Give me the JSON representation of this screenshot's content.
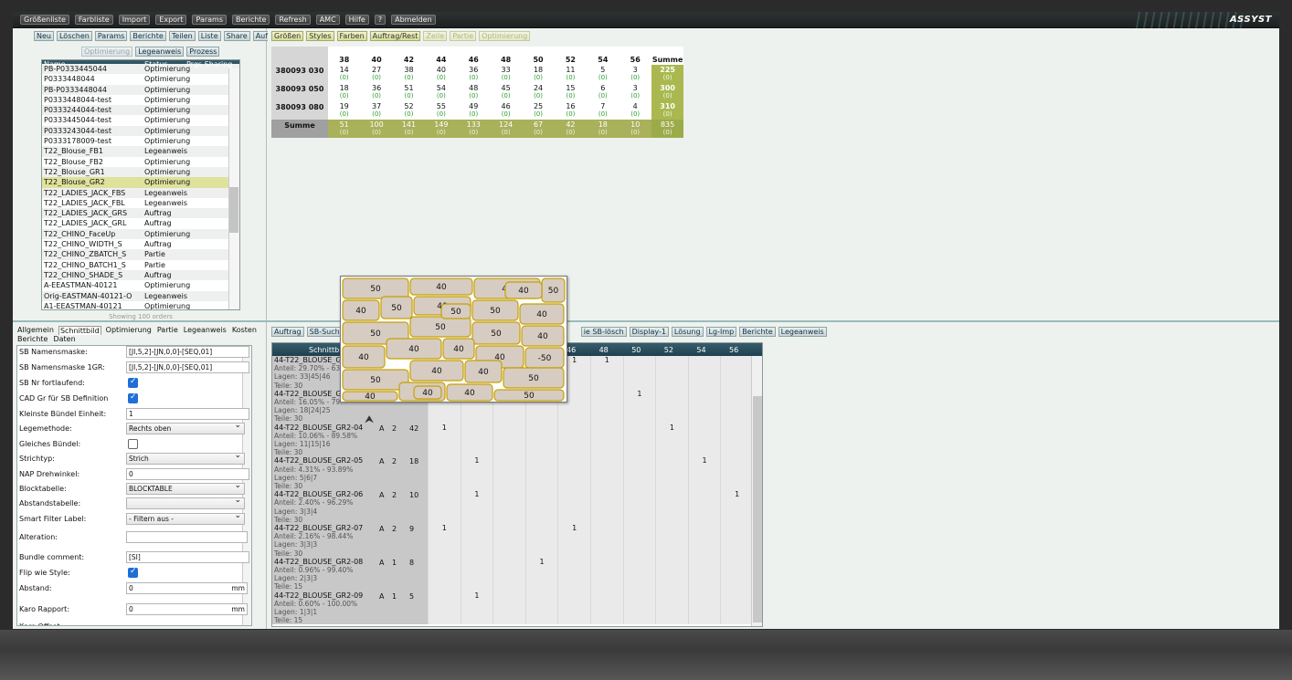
{
  "brand": "ASSYST",
  "menu": [
    "Größenliste",
    "Farbliste",
    "Import",
    "Export",
    "Params",
    "Berichte",
    "Refresh",
    "AMC",
    "Hilfe",
    "?",
    "Abmelden"
  ],
  "left_toolbar": [
    "Neu",
    "Löschen",
    "Params",
    "Berichte",
    "Teilen",
    "Liste",
    "Share",
    "Auftrag"
  ],
  "left_toolbar2": [
    {
      "label": "Optimierung",
      "disabled": true
    },
    {
      "label": "Legeanweis",
      "disabled": false
    },
    {
      "label": "Prozess",
      "disabled": false
    }
  ],
  "orders": {
    "columns": [
      "Name",
      "Status",
      "Prgs Sharing"
    ],
    "rows": [
      [
        "PB-P0333445044",
        "Optimierung"
      ],
      [
        "P0333448044",
        "Optimierung"
      ],
      [
        "PB-P0333448044",
        "Optimierung"
      ],
      [
        "P0333448044-test",
        "Optimierung"
      ],
      [
        "P0333244044-test",
        "Optimierung"
      ],
      [
        "P0333445044-test",
        "Optimierung"
      ],
      [
        "P0333243044-test",
        "Optimierung"
      ],
      [
        "P0333178009-test",
        "Optimierung"
      ],
      [
        "T22_Blouse_FB1",
        "Legeanweis"
      ],
      [
        "T22_Blouse_FB2",
        "Optimierung"
      ],
      [
        "T22_Blouse_GR1",
        "Optimierung"
      ],
      [
        "T22_Blouse_GR2",
        "Optimierung"
      ],
      [
        "T22_LADIES_JACK_FBS",
        "Legeanweis"
      ],
      [
        "T22_LADIES_JACK_FBL",
        "Legeanweis"
      ],
      [
        "T22_LADIES_JACK_GRS",
        "Auftrag"
      ],
      [
        "T22_LADIES_JACK_GRL",
        "Auftrag"
      ],
      [
        "T22_CHINO_FaceUp",
        "Optimierung"
      ],
      [
        "T22_CHINO_WIDTH_S",
        "Auftrag"
      ],
      [
        "T22_CHINO_ZBATCH_S",
        "Partie"
      ],
      [
        "T22_CHINO_BATCH1_S",
        "Partie"
      ],
      [
        "T22_CHINO_SHADE_S",
        "Auftrag"
      ],
      [
        "A-EEASTMAN-40121",
        "Optimierung"
      ],
      [
        "Orig-EASTMAN-40121-O",
        "Legeanweis"
      ],
      [
        "A1-EEASTMAN-40121",
        "Optimierung"
      ]
    ],
    "selected_index": 11,
    "footer": "Showing 100 orders"
  },
  "right_toolbar": [
    {
      "label": "Größen",
      "disabled": false
    },
    {
      "label": "Styles",
      "disabled": false
    },
    {
      "label": "Farben",
      "disabled": false
    },
    {
      "label": "Auftrag/Rest",
      "disabled": false
    },
    {
      "label": "Zeile",
      "disabled": true
    },
    {
      "label": "Partie",
      "disabled": true
    },
    {
      "label": "Optimierung",
      "disabled": true
    }
  ],
  "size_grid": {
    "sizes": [
      "38",
      "40",
      "42",
      "44",
      "46",
      "48",
      "50",
      "52",
      "54",
      "56"
    ],
    "sum_label": "Summe",
    "marker": "*",
    "rows": [
      {
        "label": "380093 030",
        "values": [
          "14",
          "27",
          "38",
          "40",
          "36",
          "33",
          "18",
          "11",
          "5",
          "3"
        ],
        "sum": "225"
      },
      {
        "label": "380093 050",
        "values": [
          "18",
          "36",
          "51",
          "54",
          "48",
          "45",
          "24",
          "15",
          "6",
          "3"
        ],
        "sum": "300"
      },
      {
        "label": "380093 080",
        "values": [
          "19",
          "37",
          "52",
          "55",
          "49",
          "46",
          "25",
          "16",
          "7",
          "4"
        ],
        "sum": "310"
      }
    ],
    "total": {
      "label": "Summe",
      "values": [
        "51",
        "100",
        "141",
        "149",
        "133",
        "124",
        "67",
        "42",
        "18",
        "10"
      ],
      "sum": "835"
    },
    "zero": "(0)"
  },
  "left_tabs": [
    "Allgemein",
    "Schnittbild",
    "Optimierung",
    "Partie",
    "Legeanweis",
    "Kosten",
    "Berichte",
    "Daten"
  ],
  "active_tab": "Schnittbild",
  "form": {
    "sb_namensmaske": {
      "label": "SB Namensmaske:",
      "value": "[JI,5,2]-[JN,0,0]-[SEQ,01]"
    },
    "sb_namensmaske_1gr": {
      "label": "SB Namensmaske 1GR:",
      "value": "[JI,5,2]-[JN,0,0]-[SEQ,01]"
    },
    "sb_nr_fortlaufend": {
      "label": "SB Nr fortlaufend:"
    },
    "cad_gr": {
      "label": "CAD Gr für SB Definition"
    },
    "kleinste_buendel": {
      "label": "Kleinste Bündel Einheit:",
      "value": "1"
    },
    "legemethode": {
      "label": "Legemethode:",
      "value": "Rechts oben"
    },
    "gleiches_buendel": {
      "label": "Gleiches Bündel:"
    },
    "strichtyp": {
      "label": "Strichtyp:",
      "value": "Strich"
    },
    "nap_drehwinkel": {
      "label": "NAP Drehwinkel:",
      "value": "0"
    },
    "blocktabelle": {
      "label": "Blocktabelle:",
      "value": "BLOCKTABLE"
    },
    "abstandstabelle": {
      "label": "Abstandstabelle:",
      "value": ""
    },
    "smart_filter": {
      "label": "Smart Filter Label:",
      "value": "- Filtern aus -"
    },
    "alteration": {
      "label": "Alteration:",
      "value": ""
    },
    "bundle_comment": {
      "label": "Bundle comment:",
      "value": "[SI]"
    },
    "flip_wie_style": {
      "label": "Flip wie Style:"
    },
    "abstand": {
      "label": "Abstand:",
      "value": "0",
      "unit": "mm"
    },
    "karo_rapport": {
      "label": "Karo Rapport:",
      "value": "0",
      "unit": "mm"
    },
    "karo_offset": {
      "label": "Karo Offset:"
    }
  },
  "bottom_toolbar": [
    "Auftrag",
    "SB-Suchen",
    "ie SB-lösch",
    "Display-1",
    "Lösung",
    "Lg-Imp",
    "Berichte",
    "Legeanweis"
  ],
  "sb_grid": {
    "header_first": "Schnittbi",
    "header_sizes": [
      "46",
      "48",
      "50",
      "52",
      "54",
      "56"
    ],
    "rows": [
      {
        "name": "44-T22_BLOUSE_G",
        "anteil": "Anteil: 29.70% - 63.",
        "lagen": "Lagen: 33|45|46",
        "teile": "Teile: 30",
        "a": "",
        "b": "",
        "c": "",
        "marks": [
          4,
          5
        ]
      },
      {
        "name": "44-T22_BLOUSE_G",
        "anteil": "Anteil: 16.05% - 79.",
        "lagen": "Lagen: 18|24|25",
        "teile": "Teile: 30",
        "a": "",
        "b": "",
        "c": "",
        "marks": [
          6
        ]
      },
      {
        "name": "44-T22_BLOUSE_GR2-04",
        "anteil": "Anteil: 10.06% - 89.58%",
        "lagen": "Lagen: 11|15|16",
        "teile": "Teile: 30",
        "a": "A",
        "b": "2",
        "c": "42",
        "marks": [
          0,
          7
        ]
      },
      {
        "name": "44-T22_BLOUSE_GR2-05",
        "anteil": "Anteil: 4.31% - 93.89%",
        "lagen": "Lagen: 5|6|7",
        "teile": "Teile: 30",
        "a": "A",
        "b": "2",
        "c": "18",
        "marks": [
          1,
          8
        ]
      },
      {
        "name": "44-T22_BLOUSE_GR2-06",
        "anteil": "Anteil: 2.40% - 96.29%",
        "lagen": "Lagen: 3|3|4",
        "teile": "Teile: 30",
        "a": "A",
        "b": "2",
        "c": "10",
        "marks": [
          1,
          9
        ]
      },
      {
        "name": "44-T22_BLOUSE_GR2-07",
        "anteil": "Anteil: 2.16% - 98.44%",
        "lagen": "Lagen: 3|3|3",
        "teile": "Teile: 30",
        "a": "A",
        "b": "2",
        "c": "9",
        "marks": [
          0,
          4
        ]
      },
      {
        "name": "44-T22_BLOUSE_GR2-08",
        "anteil": "Anteil: 0.96% - 99.40%",
        "lagen": "Lagen: 2|3|3",
        "teile": "Teile: 15",
        "a": "A",
        "b": "1",
        "c": "8",
        "marks": [
          3
        ]
      },
      {
        "name": "44-T22_BLOUSE_GR2-09",
        "anteil": "Anteil: 0.60% - 100.00%",
        "lagen": "Lagen: 1|3|1",
        "teile": "Teile: 15",
        "a": "A",
        "b": "1",
        "c": "5",
        "marks": [
          1
        ]
      }
    ],
    "mark": "1"
  },
  "popup_labels": [
    "50",
    "40",
    "40",
    "50",
    "40",
    "50",
    "40",
    "50",
    "40",
    "50",
    "50",
    "50",
    "40",
    "40",
    "40",
    "40",
    "40",
    "-50",
    "50",
    "40",
    "40",
    "50",
    "40",
    "40",
    "40",
    "50",
    "40",
    "50",
    "40"
  ]
}
